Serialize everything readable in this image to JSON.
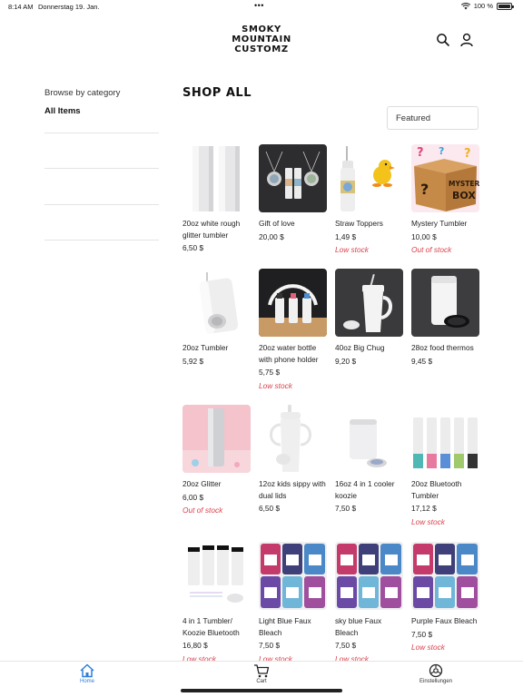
{
  "status_bar": {
    "time": "8:14 AM",
    "date": "Donnerstag 19. Jan.",
    "dots": "•••",
    "battery": "100 %",
    "battery_level": 1.0
  },
  "header": {
    "logo_lines": [
      "SMOKY",
      "MOUNTAIN",
      "CUSTOMZ"
    ],
    "search_icon": "search-icon",
    "account_icon": "user-icon"
  },
  "sidebar": {
    "title": "Browse by category",
    "items": [
      {
        "label": "All Items"
      }
    ]
  },
  "shop": {
    "title": "SHOP ALL",
    "sort": {
      "selected": "Featured"
    }
  },
  "products": [
    {
      "name": "20oz white rough glitter tumbler",
      "price": "6,50 $",
      "stock": ""
    },
    {
      "name": "Gift of love",
      "price": "20,00 $",
      "stock": ""
    },
    {
      "name": "Straw Toppers",
      "price": "1,49 $",
      "stock": "Low stock"
    },
    {
      "name": "Mystery Tumbler",
      "price": "10,00 $",
      "stock": "Out of stock"
    },
    {
      "name": "20oz Tumbler",
      "price": "5,92 $",
      "stock": ""
    },
    {
      "name": "20oz water bottle with phone holder",
      "price": "5,75 $",
      "stock": "Low stock"
    },
    {
      "name": "40oz Big Chug",
      "price": "9,20 $",
      "stock": ""
    },
    {
      "name": "28oz food thermos",
      "price": "9,45 $",
      "stock": ""
    },
    {
      "name": "20oz Glitter",
      "price": "6,00 $",
      "stock": "Out of stock"
    },
    {
      "name": "12oz kids sippy with dual lids",
      "price": "6,50 $",
      "stock": ""
    },
    {
      "name": "16oz 4 in 1 cooler koozie",
      "price": "7,50 $",
      "stock": ""
    },
    {
      "name": "20oz Bluetooth Tumbler",
      "price": "17,12 $",
      "stock": "Low stock"
    },
    {
      "name": "4 in 1 Tumbler/ Koozie Bluetooth",
      "price": "16,80 $",
      "stock": "Low stock"
    },
    {
      "name": "Light Blue Faux Bleach",
      "price": "7,50 $",
      "stock": "Low stock"
    },
    {
      "name": "sky blue Faux Bleach",
      "price": "7,50 $",
      "stock": "Low stock"
    },
    {
      "name": "Purple Faux Bleach",
      "price": "7,50 $",
      "stock": "Low stock"
    }
  ],
  "tabbar": {
    "items": [
      {
        "label": "Home",
        "icon": "home-icon",
        "active": true
      },
      {
        "label": "Cart",
        "icon": "cart-icon",
        "active": false
      },
      {
        "label": "Einstellungen",
        "icon": "settings-icon",
        "active": false
      }
    ]
  },
  "colors": {
    "accent": "#2f7fd8",
    "stock_warning": "#d9414d"
  }
}
